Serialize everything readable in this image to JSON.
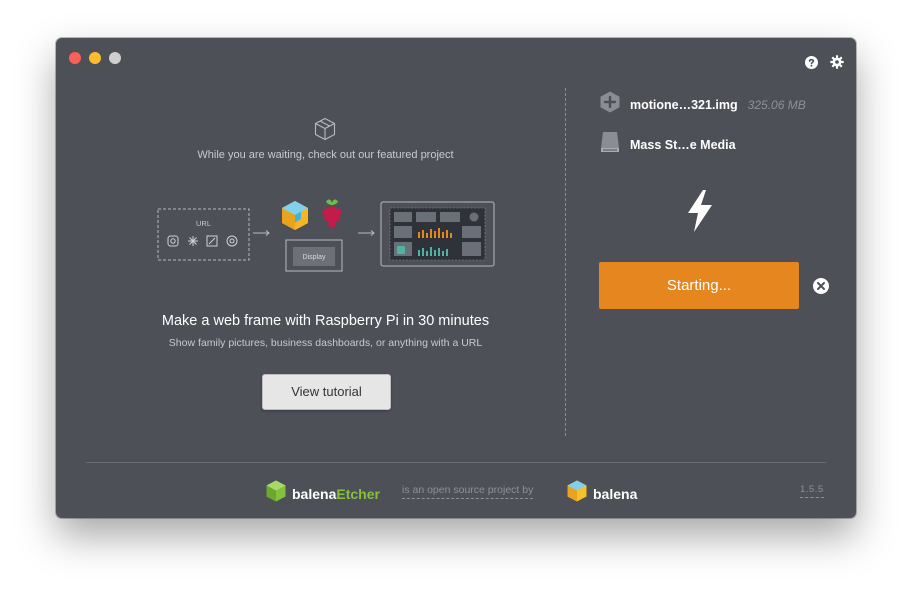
{
  "left": {
    "waiting_text": "While you are waiting, check out our featured project",
    "diagram": {
      "url_label": "URL",
      "display_label": "Display"
    },
    "project_title": "Make a web frame with Raspberry Pi in 30 minutes",
    "project_subtitle": "Show family pictures, business dashboards, or anything with a URL",
    "tutorial_button": "View tutorial"
  },
  "right": {
    "image_name": "motione…321.img",
    "image_size": "325.06 MB",
    "drive_name": "Mass St…e Media",
    "flash_button": "Starting..."
  },
  "footer": {
    "etcher_brand": "balena",
    "etcher_accent": "Etcher",
    "oss_text": "is an open source project by",
    "balena_brand": "balena",
    "version": "1.5.5"
  },
  "icons": {
    "help": "help-icon",
    "settings": "gear-icon",
    "cube": "cube-icon",
    "image": "hexagon-plus-icon",
    "drive": "drive-icon",
    "flash": "lightning-icon",
    "cancel": "cancel-icon"
  },
  "colors": {
    "window_bg": "#4d5057",
    "accent_orange": "#e5861f",
    "etcher_green": "#85c13e",
    "muted_text": "#8e9197"
  }
}
